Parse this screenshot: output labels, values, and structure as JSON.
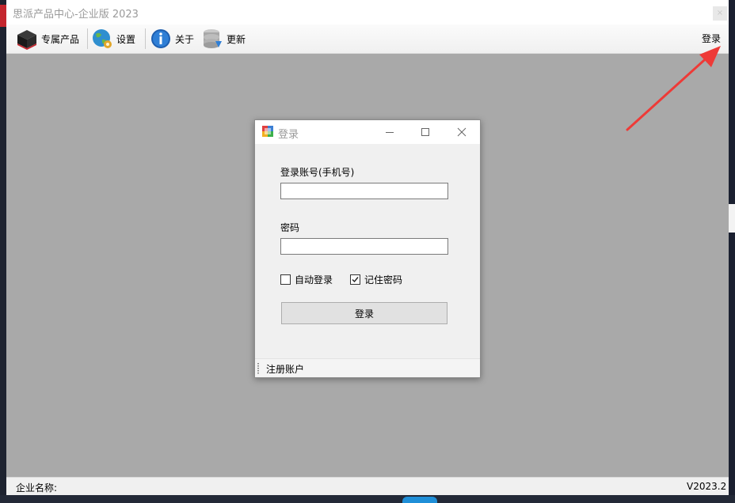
{
  "window": {
    "title": "思派产品中心-企业版 2023",
    "close_glyph": "×"
  },
  "toolbar": {
    "items": [
      {
        "label": "专属产品",
        "icon": "black-box-icon"
      },
      {
        "label": "设置",
        "icon": "globe-gear-icon"
      },
      {
        "label": "关于",
        "icon": "info-icon"
      },
      {
        "label": "更新",
        "icon": "database-download-icon"
      }
    ],
    "login_label": "登录"
  },
  "statusbar": {
    "company_label": "企业名称:",
    "version": "V2023.2"
  },
  "login_dialog": {
    "title": "登录",
    "account_label": "登录账号(手机号)",
    "account_value": "",
    "password_label": "密码",
    "password_value": "",
    "auto_login": {
      "label": "自动登录",
      "checked": false
    },
    "remember_password": {
      "label": "记住密码",
      "checked": true
    },
    "submit_label": "登录",
    "register_label": "注册账户"
  },
  "colors": {
    "arrow": "#ee3a37",
    "workspace": "#a9a9a9"
  }
}
